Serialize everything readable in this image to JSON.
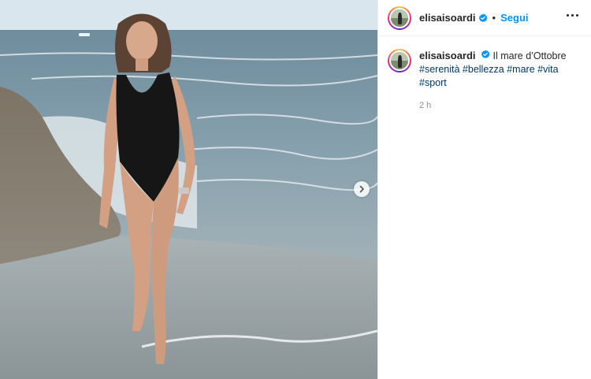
{
  "post": {
    "username": "elisaisoardi",
    "follow_label": "Segui",
    "separator": "•",
    "caption_text": "Il mare d’Ottobre",
    "hashtags": [
      "#serenità",
      "#bellezza",
      "#mare",
      "#vita",
      "#sport"
    ],
    "time": "2 h"
  },
  "icons": {
    "verified": "verified-badge-icon",
    "more": "more-options-icon",
    "next": "chevron-right-icon"
  },
  "colors": {
    "follow": "#0095f6",
    "hashtag": "#00376b",
    "verified": "#0095f6",
    "muted": "#8e8e8e"
  }
}
